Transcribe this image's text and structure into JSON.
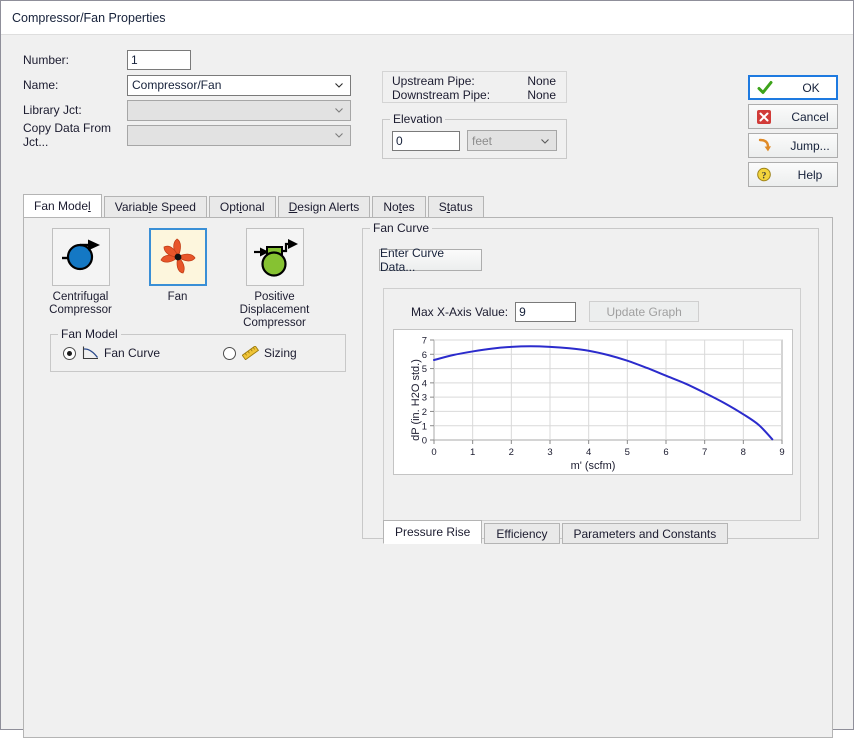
{
  "window": {
    "title": "Compressor/Fan Properties"
  },
  "form": {
    "number": {
      "label": "Number:",
      "value": "1"
    },
    "name": {
      "label": "Name:",
      "value": "Compressor/Fan"
    },
    "library_jct": {
      "label": "Library Jct:",
      "value": ""
    },
    "copy_data_from_jct": {
      "label": "Copy Data From Jct...",
      "value": ""
    }
  },
  "pipes": {
    "upstream_label": "Upstream Pipe:",
    "upstream_value": "None",
    "downstream_label": "Downstream Pipe:",
    "downstream_value": "None"
  },
  "elevation": {
    "title": "Elevation",
    "value": "0",
    "units": "feet"
  },
  "buttons": {
    "ok": {
      "label": "OK",
      "icon": "green-check-icon"
    },
    "cancel": {
      "label": "Cancel",
      "icon": "red-x-icon"
    },
    "jump": {
      "label": "Jump...",
      "icon": "orange-arrow-icon"
    },
    "help": {
      "label": "Help",
      "icon": "question-mark-icon"
    }
  },
  "tabs": [
    {
      "label": "Fan Model",
      "mnemonic": "l",
      "active": true
    },
    {
      "label": "Variable Speed",
      "mnemonic": "l",
      "active": false
    },
    {
      "label": "Optional",
      "mnemonic": "i",
      "active": false
    },
    {
      "label": "Design Alerts",
      "mnemonic": "D",
      "active": false
    },
    {
      "label": "Notes",
      "mnemonic": "t",
      "active": false
    },
    {
      "label": "Status",
      "mnemonic": "t",
      "active": false
    }
  ],
  "equipment": [
    {
      "caption": "Centrifugal\nCompressor",
      "icon": "centrifugal-compressor-icon",
      "selected": false
    },
    {
      "caption": "Fan",
      "icon": "fan-icon",
      "selected": true
    },
    {
      "caption": "Positive\nDisplacement\nCompressor",
      "icon": "positive-displacement-compressor-icon",
      "selected": false
    }
  ],
  "fan_model": {
    "title": "Fan Model",
    "options": [
      {
        "label": "Fan Curve",
        "icon": "curve-icon",
        "selected": true
      },
      {
        "label": "Sizing",
        "icon": "ruler-icon",
        "selected": false
      }
    ]
  },
  "fan_curve": {
    "title": "Fan Curve",
    "enter_curve_data": "Enter Curve Data...",
    "max_x_label": "Max X-Axis Value:",
    "max_x_value": "9",
    "update_graph": "Update Graph",
    "update_graph_enabled": false
  },
  "sub_tabs": [
    {
      "label": "Pressure Rise",
      "active": true
    },
    {
      "label": "Efficiency",
      "active": false
    },
    {
      "label": "Parameters and Constants",
      "active": false
    }
  ],
  "colors": {
    "curve": "#2b2bcc",
    "accent": "#1e7ae0",
    "fan_blade": "#e8562a",
    "compressor_blue": "#1478c4",
    "pd_green": "#86c232"
  },
  "chart_data": {
    "type": "line",
    "title": "",
    "xlabel": "m'  (scfm)",
    "ylabel": "dP (in. H2O std.)",
    "xlim": [
      0,
      9
    ],
    "ylim": [
      0,
      7
    ],
    "xticks": [
      0,
      1,
      2,
      3,
      4,
      5,
      6,
      7,
      8,
      9
    ],
    "yticks": [
      0,
      1,
      2,
      3,
      4,
      5,
      6,
      7
    ],
    "grid": true,
    "legend": "none",
    "series": [
      {
        "name": "Pressure Rise",
        "color": "#2b2bcc",
        "x": [
          0,
          0.5,
          1,
          1.5,
          2,
          2.5,
          3,
          3.5,
          4,
          4.5,
          5,
          5.5,
          6,
          6.5,
          7,
          7.5,
          8,
          8.4,
          8.75
        ],
        "y": [
          5.6,
          5.95,
          6.2,
          6.4,
          6.52,
          6.56,
          6.52,
          6.42,
          6.25,
          5.95,
          5.55,
          5.05,
          4.5,
          3.95,
          3.3,
          2.6,
          1.8,
          1.05,
          0.05
        ]
      }
    ]
  }
}
